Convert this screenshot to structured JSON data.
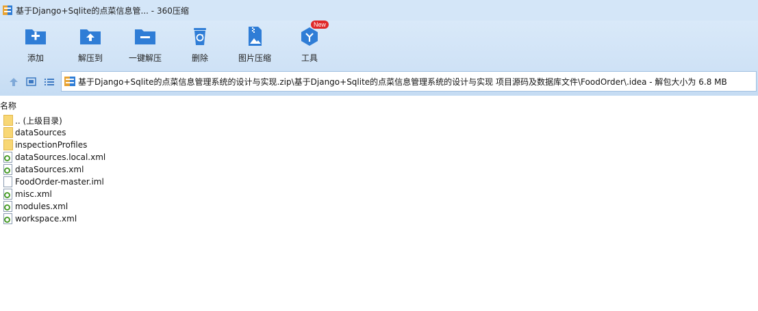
{
  "window": {
    "title": "基于Django+Sqlite的点菜信息管... - 360压缩",
    "app_icon": "360zip-icon"
  },
  "toolbar": {
    "items": [
      {
        "label": "添加",
        "icon": "add-folder-icon"
      },
      {
        "label": "解压到",
        "icon": "extract-to-icon"
      },
      {
        "label": "一键解压",
        "icon": "one-click-extract-icon"
      },
      {
        "label": "删除",
        "icon": "recycle-bin-icon"
      },
      {
        "label": "图片压缩",
        "icon": "image-compress-icon"
      },
      {
        "label": "工具",
        "icon": "tools-cube-icon",
        "badge": "New"
      }
    ],
    "accent": "#2f7dd6"
  },
  "address": {
    "path": "基于Django+Sqlite的点菜信息管理系统的设计与实现.zip\\基于Django+Sqlite的点菜信息管理系统的设计与实现 项目源码及数据库文件\\FoodOrder\\.idea - 解包大小为 6.8 MB"
  },
  "list": {
    "column_name": "名称",
    "files": [
      {
        "name": ".. (上级目录)",
        "type": "folder"
      },
      {
        "name": "dataSources",
        "type": "folder"
      },
      {
        "name": "inspectionProfiles",
        "type": "folder"
      },
      {
        "name": "dataSources.local.xml",
        "type": "xml"
      },
      {
        "name": "dataSources.xml",
        "type": "xml"
      },
      {
        "name": "FoodOrder-master.iml",
        "type": "doc"
      },
      {
        "name": "misc.xml",
        "type": "xml"
      },
      {
        "name": "modules.xml",
        "type": "xml"
      },
      {
        "name": "workspace.xml",
        "type": "xml"
      }
    ]
  }
}
